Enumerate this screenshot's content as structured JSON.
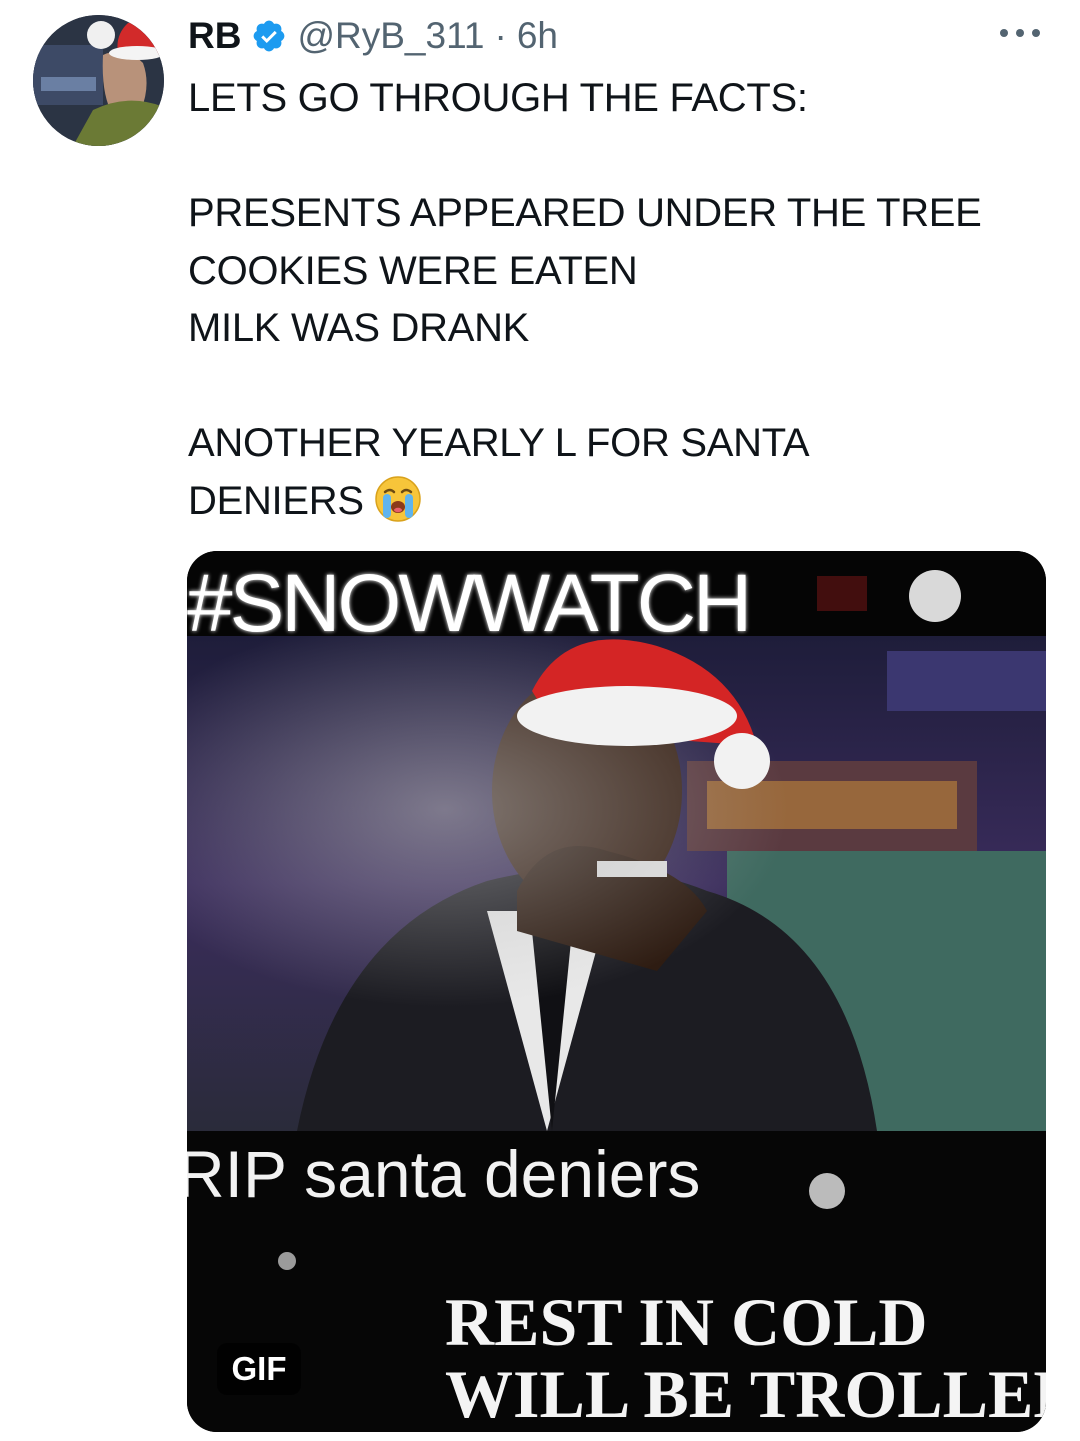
{
  "user": {
    "name": "RB",
    "handle": "@RyB_311",
    "separator": "·",
    "time": "6h",
    "verified": true
  },
  "tweet": {
    "lines": [
      "LETS GO THROUGH THE FACTS:",
      "",
      "PRESENTS APPEARED UNDER THE TREE",
      "COOKIES WERE EATEN",
      "MILK WAS DRANK",
      "",
      "ANOTHER YEARLY L FOR SANTA",
      "DENIERS"
    ],
    "emoji": "loudly-crying-face"
  },
  "media": {
    "type": "gif",
    "badge": "GIF",
    "overlay_text": {
      "top": "#SNOWWATCH",
      "middle": "RIP santa deniers",
      "bottom_1": "REST IN COLD",
      "bottom_2": "WILL BE TROLLED"
    }
  },
  "colors": {
    "text": "#0f1419",
    "secondary": "#536471",
    "verified_badge": "#1d9bf0",
    "background": "#ffffff"
  },
  "icons": [
    "verified-badge-icon",
    "more-options-icon",
    "crying-face-emoji"
  ]
}
